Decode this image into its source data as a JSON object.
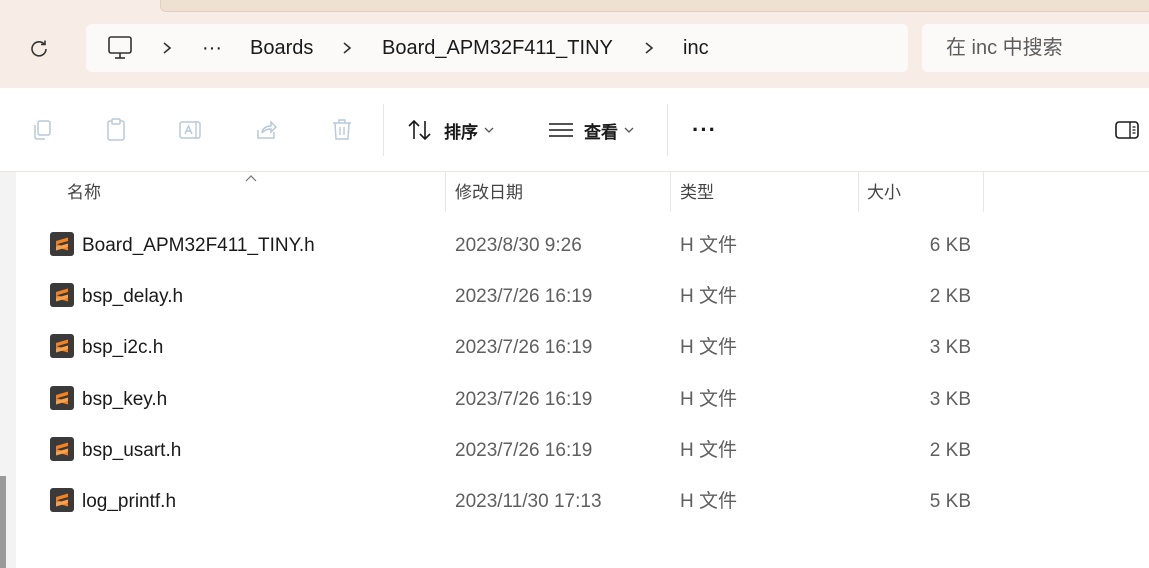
{
  "address": {
    "refresh_icon": "refresh-icon",
    "computer_icon": "monitor-icon",
    "overflow": "···",
    "breadcrumbs": [
      "Boards",
      "Board_APM32F411_TINY",
      "inc"
    ]
  },
  "search": {
    "placeholder": "在 inc 中搜索"
  },
  "toolbar": {
    "icons": [
      "copy-icon",
      "paste-icon",
      "rename-icon",
      "share-icon",
      "delete-icon"
    ],
    "sort_label": "排序",
    "view_label": "查看",
    "more_label": "···",
    "details_pane_icon": "details-pane-icon"
  },
  "columns": {
    "name": "名称",
    "modified": "修改日期",
    "type": "类型",
    "size": "大小"
  },
  "files": [
    {
      "name": "Board_APM32F411_TINY.h",
      "modified": "2023/8/30 9:26",
      "type": "H 文件",
      "size": "6 KB"
    },
    {
      "name": "bsp_delay.h",
      "modified": "2023/7/26 16:19",
      "type": "H 文件",
      "size": "2 KB"
    },
    {
      "name": "bsp_i2c.h",
      "modified": "2023/7/26 16:19",
      "type": "H 文件",
      "size": "3 KB"
    },
    {
      "name": "bsp_key.h",
      "modified": "2023/7/26 16:19",
      "type": "H 文件",
      "size": "3 KB"
    },
    {
      "name": "bsp_usart.h",
      "modified": "2023/7/26 16:19",
      "type": "H 文件",
      "size": "2 KB"
    },
    {
      "name": "log_printf.h",
      "modified": "2023/11/30 17:13",
      "type": "H 文件",
      "size": "5 KB"
    }
  ],
  "colors": {
    "accent": "#f58220",
    "window_tint": "#f8ede6"
  }
}
